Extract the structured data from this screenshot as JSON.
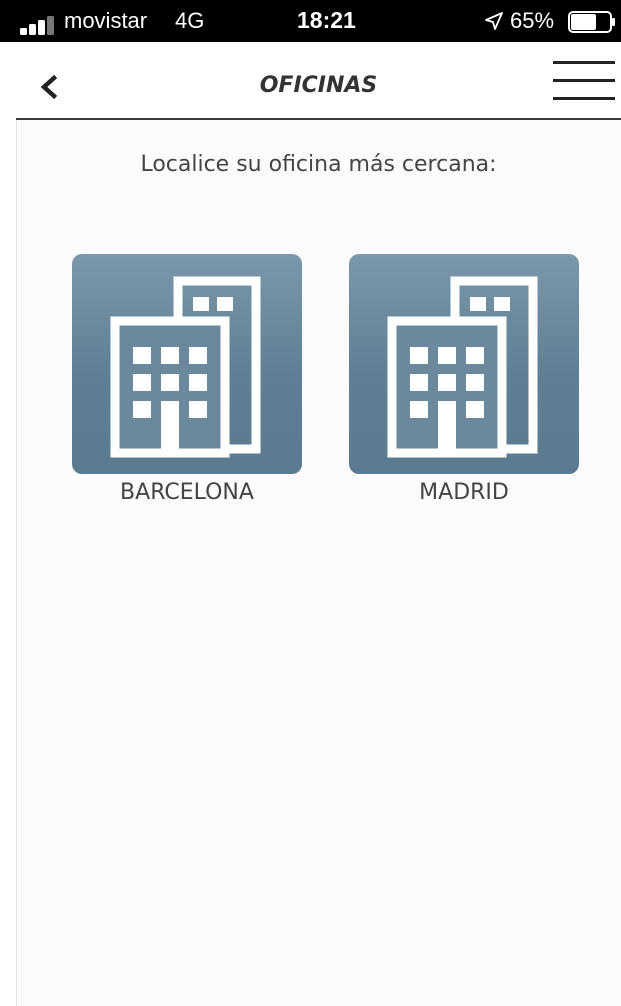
{
  "status_bar": {
    "carrier": "movistar",
    "network": "4G",
    "time": "18:21",
    "battery_percent": "65%",
    "battery_level": 0.65,
    "signal_bars_active": 3,
    "signal_bars_total": 4,
    "icons": [
      "signal-icon",
      "location-arrow-icon",
      "battery-icon"
    ]
  },
  "header": {
    "title": "OFICINAS",
    "back_icon": "chevron-left-icon",
    "menu_icon": "hamburger-menu-icon"
  },
  "main": {
    "subtitle": "Localice su oficina más cercana:",
    "offices": [
      {
        "label": "BARCELONA",
        "icon": "building-icon"
      },
      {
        "label": "MADRID",
        "icon": "building-icon"
      }
    ]
  },
  "colors": {
    "status_bar_bg": "#000000",
    "tile_top": "#7a98aa",
    "tile_bottom": "#5a7b90",
    "text": "#444444",
    "nav_divider": "#3a3a3a",
    "icon_fg": "#ffffff"
  }
}
